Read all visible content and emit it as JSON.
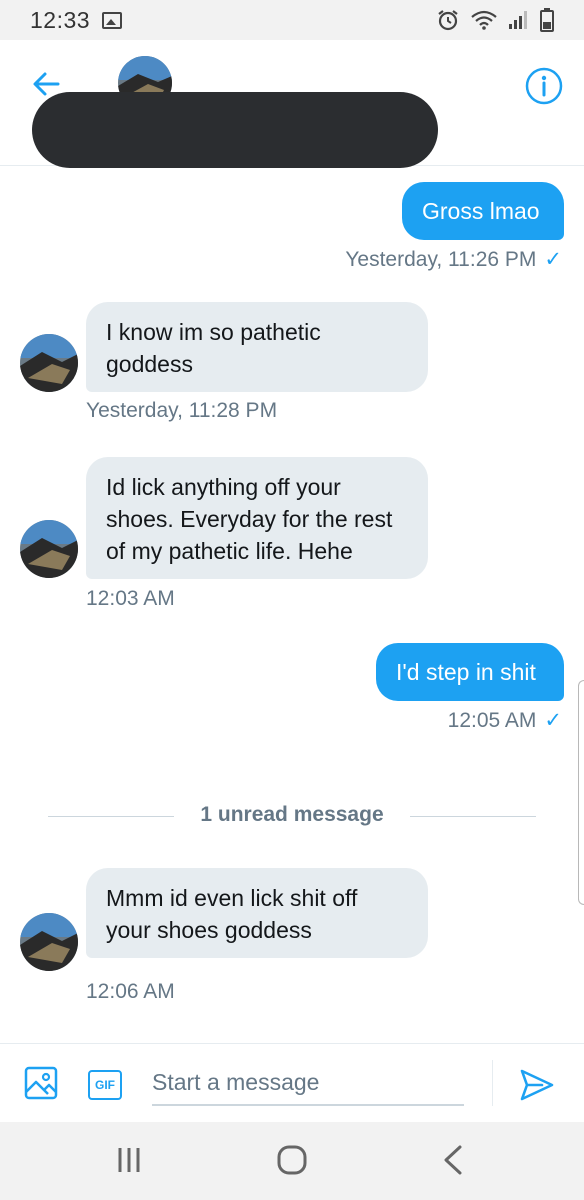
{
  "status_bar": {
    "time": "12:33"
  },
  "header": {},
  "messages": [
    {
      "direction": "out",
      "text": "Gross lmao",
      "timestamp": "Yesterday, 11:26 PM",
      "read_check": "✓"
    },
    {
      "direction": "in",
      "text": "I know im so pathetic goddess",
      "timestamp": "Yesterday, 11:28 PM"
    },
    {
      "direction": "in",
      "text": "Id lick anything off your shoes. Everyday for the rest of my pathetic life. Hehe",
      "timestamp": "12:03 AM"
    },
    {
      "direction": "out",
      "text": "I'd step in shit",
      "timestamp": "12:05 AM",
      "read_check": "✓"
    },
    {
      "direction": "in",
      "text": "Mmm id even lick shit off your shoes goddess",
      "timestamp": "12:06 AM"
    }
  ],
  "unread_divider": "1 unread message",
  "composer": {
    "placeholder": "Start a message",
    "gif_label": "GIF"
  },
  "colors": {
    "accent": "#1da1f2",
    "incoming_bubble": "#e6ecf0",
    "secondary_text": "#657786"
  },
  "icons": [
    "back-arrow-icon",
    "info-icon",
    "image-icon",
    "gif-icon",
    "send-icon",
    "alarm-icon",
    "wifi-icon",
    "signal-icon",
    "battery-icon"
  ]
}
